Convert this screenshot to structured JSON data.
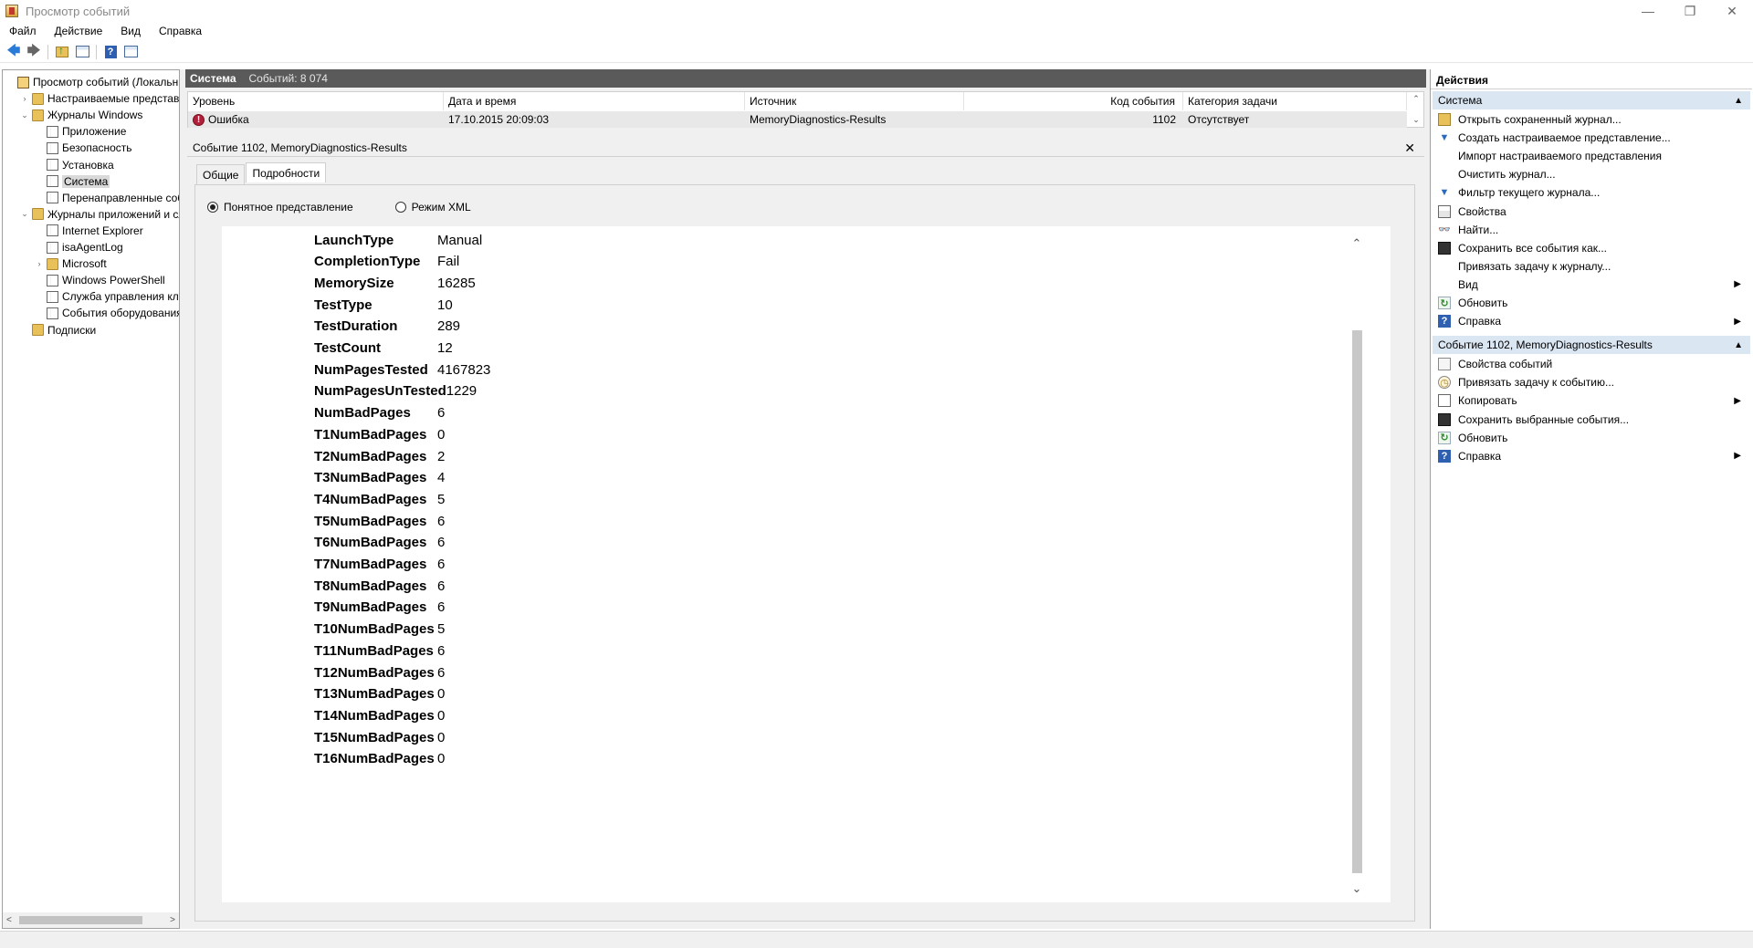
{
  "window": {
    "title": "Просмотр событий",
    "controls": {
      "minimize": "—",
      "restore": "❐",
      "close": "✕"
    }
  },
  "menu": [
    "Файл",
    "Действие",
    "Вид",
    "Справка"
  ],
  "toolbar": {
    "icons": [
      "back-arrow",
      "forward-arrow",
      "up-folder",
      "show-hide-tree",
      "help",
      "show-hide-actions"
    ],
    "back_glyph": "🡄",
    "forward_glyph": "🡆",
    "help_glyph": "?"
  },
  "tree": [
    {
      "label": "Просмотр событий (Локальны",
      "level": 0,
      "toggle": "",
      "icon": "viewer"
    },
    {
      "label": "Настраиваемые представле",
      "level": 1,
      "toggle": "›",
      "icon": "folder"
    },
    {
      "label": "Журналы Windows",
      "level": 1,
      "toggle": "⌄",
      "icon": "folder"
    },
    {
      "label": "Приложение",
      "level": 2,
      "toggle": "",
      "icon": "log"
    },
    {
      "label": "Безопасность",
      "level": 2,
      "toggle": "",
      "icon": "log"
    },
    {
      "label": "Установка",
      "level": 2,
      "toggle": "",
      "icon": "log"
    },
    {
      "label": "Система",
      "level": 2,
      "toggle": "",
      "icon": "log",
      "selected": true
    },
    {
      "label": "Перенаправленные соб",
      "level": 2,
      "toggle": "",
      "icon": "log"
    },
    {
      "label": "Журналы приложений и сл",
      "level": 1,
      "toggle": "⌄",
      "icon": "folder"
    },
    {
      "label": "Internet Explorer",
      "level": 2,
      "toggle": "",
      "icon": "log"
    },
    {
      "label": "isaAgentLog",
      "level": 2,
      "toggle": "",
      "icon": "log"
    },
    {
      "label": "Microsoft",
      "level": 2,
      "toggle": "›",
      "icon": "folder"
    },
    {
      "label": "Windows PowerShell",
      "level": 2,
      "toggle": "",
      "icon": "log"
    },
    {
      "label": "Служба управления клю",
      "level": 2,
      "toggle": "",
      "icon": "log"
    },
    {
      "label": "События оборудования",
      "level": 2,
      "toggle": "",
      "icon": "log"
    },
    {
      "label": "Подписки",
      "level": 1,
      "toggle": "",
      "icon": "folder"
    }
  ],
  "tree_scroll": {
    "left": "<",
    "right": ">"
  },
  "list": {
    "title": "Система",
    "count": "Событий: 8 074",
    "columns": [
      "Уровень",
      "Дата и время",
      "Источник",
      "Код события",
      "Категория задачи"
    ],
    "rows": [
      {
        "level": "Ошибка",
        "datetime": "17.10.2015 20:09:03",
        "source": "MemoryDiagnostics-Results",
        "event_id": "1102",
        "category": "Отсутствует"
      }
    ],
    "scroll_up": "⌃",
    "scroll_down": "⌄"
  },
  "detail": {
    "title": "Событие 1102, MemoryDiagnostics-Results",
    "close": "✕",
    "tabs": [
      "Общие",
      "Подробности"
    ],
    "active_tab": 1,
    "radio_friendly": "Понятное представление",
    "radio_xml": "Режим XML",
    "selected_view": "friendly",
    "fields": [
      {
        "key": "LaunchType",
        "value": "Manual"
      },
      {
        "key": "CompletionType",
        "value": "Fail"
      },
      {
        "key": "MemorySize",
        "value": "16285"
      },
      {
        "key": "TestType",
        "value": "10"
      },
      {
        "key": "TestDuration",
        "value": "289"
      },
      {
        "key": "TestCount",
        "value": "12"
      },
      {
        "key": "NumPagesTested",
        "value": "4167823"
      },
      {
        "key": "NumPagesUnTested",
        "value": "1229"
      },
      {
        "key": "NumBadPages",
        "value": "6"
      },
      {
        "key": "T1NumBadPages",
        "value": "0"
      },
      {
        "key": "T2NumBadPages",
        "value": "2"
      },
      {
        "key": "T3NumBadPages",
        "value": "4"
      },
      {
        "key": "T4NumBadPages",
        "value": "5"
      },
      {
        "key": "T5NumBadPages",
        "value": "6"
      },
      {
        "key": "T6NumBadPages",
        "value": "6"
      },
      {
        "key": "T7NumBadPages",
        "value": "6"
      },
      {
        "key": "T8NumBadPages",
        "value": "6"
      },
      {
        "key": "T9NumBadPages",
        "value": "6"
      },
      {
        "key": "T10NumBadPages",
        "value": "5"
      },
      {
        "key": "T11NumBadPages",
        "value": "6"
      },
      {
        "key": "T12NumBadPages",
        "value": "6"
      },
      {
        "key": "T13NumBadPages",
        "value": "0"
      },
      {
        "key": "T14NumBadPages",
        "value": "0"
      },
      {
        "key": "T15NumBadPages",
        "value": "0"
      },
      {
        "key": "T16NumBadPages",
        "value": "0"
      }
    ],
    "scroll_up": "⌃",
    "scroll_down": "⌄"
  },
  "actions": {
    "title": "Действия",
    "sections": [
      {
        "title": "Система",
        "collapse": "▲",
        "items": [
          {
            "label": "Открыть сохраненный журнал...",
            "icon": "open-log",
            "glyph": "",
            "sub": ""
          },
          {
            "label": "Создать настраиваемое представление...",
            "icon": "filter",
            "glyph": "▼",
            "sub": ""
          },
          {
            "label": "Импорт настраиваемого представления",
            "icon": "none",
            "glyph": "",
            "sub": ""
          },
          {
            "label": "Очистить журнал...",
            "icon": "none",
            "glyph": "",
            "sub": ""
          },
          {
            "label": "Фильтр текущего журнала...",
            "icon": "filter",
            "glyph": "▼",
            "sub": ""
          },
          {
            "label": "Свойства",
            "icon": "properties",
            "glyph": "",
            "sub": ""
          },
          {
            "label": "Найти...",
            "icon": "find",
            "glyph": "👓",
            "sub": ""
          },
          {
            "label": "Сохранить все события как...",
            "icon": "save",
            "glyph": "",
            "sub": ""
          },
          {
            "label": "Привязать задачу к журналу...",
            "icon": "none",
            "glyph": "",
            "sub": ""
          },
          {
            "label": "Вид",
            "icon": "none",
            "glyph": "",
            "sub": "▶"
          },
          {
            "label": "Обновить",
            "icon": "refresh",
            "glyph": "↻",
            "sub": ""
          },
          {
            "label": "Справка",
            "icon": "help",
            "glyph": "?",
            "sub": "▶"
          }
        ]
      },
      {
        "title": "Событие 1102, MemoryDiagnostics-Results",
        "collapse": "▲",
        "items": [
          {
            "label": "Свойства событий",
            "icon": "event-properties",
            "glyph": "",
            "sub": ""
          },
          {
            "label": "Привязать задачу к событию...",
            "icon": "attach-task",
            "glyph": "◷",
            "sub": ""
          },
          {
            "label": "Копировать",
            "icon": "copy",
            "glyph": "",
            "sub": "▶"
          },
          {
            "label": "Сохранить выбранные события...",
            "icon": "save",
            "glyph": "",
            "sub": ""
          },
          {
            "label": "Обновить",
            "icon": "refresh",
            "glyph": "↻",
            "sub": ""
          },
          {
            "label": "Справка",
            "icon": "help",
            "glyph": "?",
            "sub": "▶"
          }
        ]
      }
    ]
  }
}
